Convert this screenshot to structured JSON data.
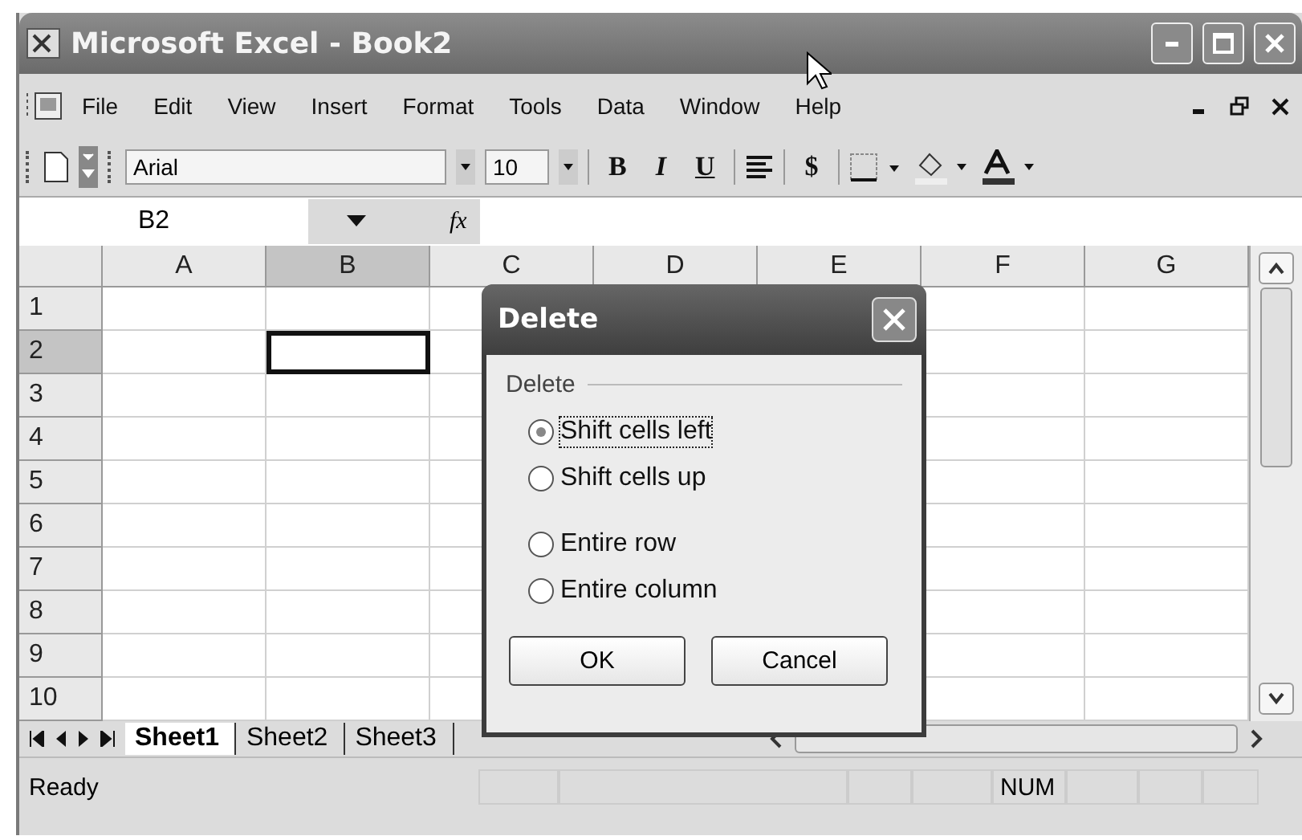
{
  "window": {
    "title": "Microsoft Excel - Book2"
  },
  "menu": [
    {
      "label": "File"
    },
    {
      "label": "Edit"
    },
    {
      "label": "View"
    },
    {
      "label": "Insert"
    },
    {
      "label": "Format"
    },
    {
      "label": "Tools"
    },
    {
      "label": "Data"
    },
    {
      "label": "Window"
    },
    {
      "label": "Help"
    }
  ],
  "toolbar": {
    "font": "Arial",
    "size": "10",
    "styles": [
      {
        "label": "B",
        "kind": "bold"
      },
      {
        "label": "I",
        "kind": "italic"
      },
      {
        "label": "U",
        "kind": "underline"
      }
    ],
    "currency": "$"
  },
  "formula_bar": {
    "name_box": "B2",
    "fx": "fx"
  },
  "grid": {
    "columns": [
      {
        "label": "A",
        "selected": false
      },
      {
        "label": "B",
        "selected": true
      },
      {
        "label": "C",
        "selected": false
      },
      {
        "label": "D",
        "selected": false
      },
      {
        "label": "E",
        "selected": false
      },
      {
        "label": "F",
        "selected": false
      },
      {
        "label": "G",
        "selected": false
      }
    ],
    "rows": [
      {
        "label": "1",
        "selected": false
      },
      {
        "label": "2",
        "selected": true
      },
      {
        "label": "3",
        "selected": false
      },
      {
        "label": "4",
        "selected": false
      },
      {
        "label": "5",
        "selected": false
      },
      {
        "label": "6",
        "selected": false
      },
      {
        "label": "7",
        "selected": false
      },
      {
        "label": "8",
        "selected": false
      },
      {
        "label": "9",
        "selected": false
      },
      {
        "label": "10",
        "selected": false
      }
    ]
  },
  "sheet_tabs": [
    {
      "label": "Sheet1",
      "selected": true
    },
    {
      "label": "Sheet2",
      "selected": false
    },
    {
      "label": "Sheet3",
      "selected": false
    }
  ],
  "status_bar": {
    "status": "Ready",
    "indicator": "NUM"
  },
  "dialog": {
    "title": "Delete",
    "group": "Delete",
    "options": [
      {
        "label": "Shift cells left",
        "selected": true
      },
      {
        "label": "Shift cells up",
        "selected": false
      },
      {
        "label": "Entire row",
        "selected": false
      },
      {
        "label": "Entire column",
        "selected": false
      }
    ],
    "buttons": [
      "OK",
      "Cancel"
    ]
  }
}
